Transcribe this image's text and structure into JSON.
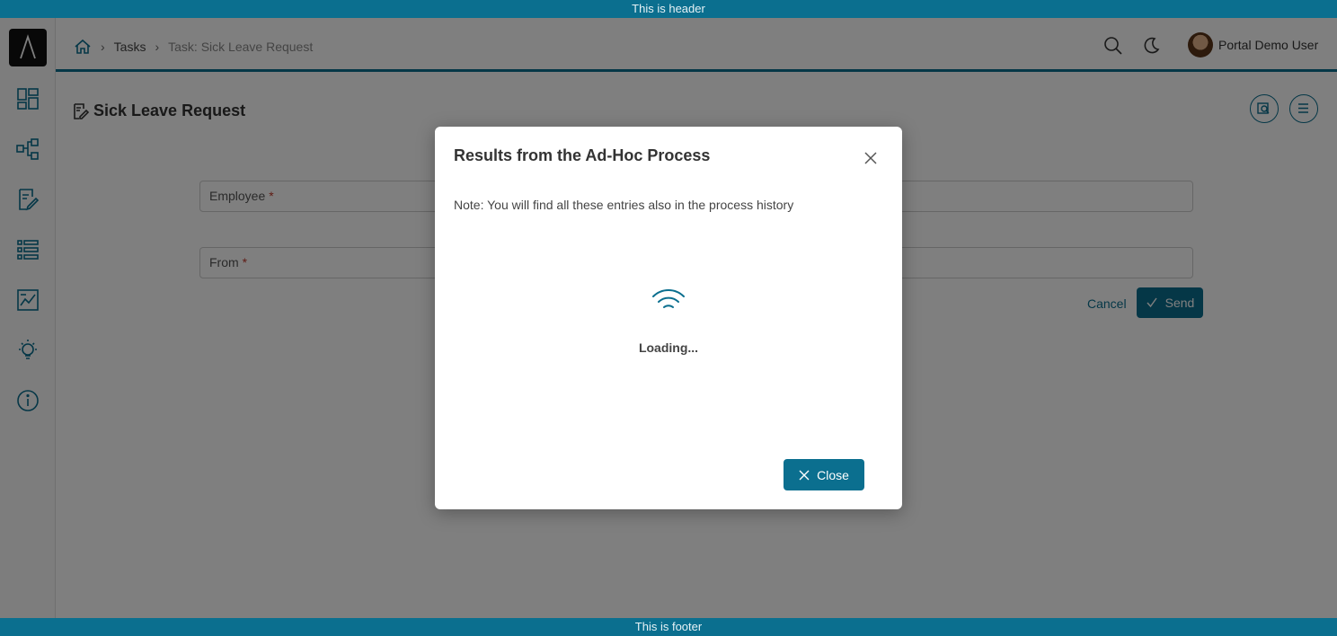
{
  "banner": {
    "header": "This is header",
    "footer": "This is footer"
  },
  "breadcrumb": {
    "tasks": "Tasks",
    "current": "Task: Sick Leave Request"
  },
  "user": {
    "name": "Portal Demo User"
  },
  "page": {
    "title": "Sick Leave Request"
  },
  "form": {
    "employee_label": "Employee",
    "from_label": "From",
    "required_mark": "*",
    "cancel_label": "Cancel",
    "send_label": "Send"
  },
  "dialog": {
    "title": "Results from the Ad-Hoc Process",
    "note": "Note: You will find all these entries also in the process history",
    "loading": "Loading...",
    "close_label": "Close"
  },
  "colors": {
    "accent": "#0b6f8f",
    "required": "#c0392b"
  },
  "icons": {
    "sidebar": [
      "dashboard-icon",
      "process-icon",
      "tasks-icon",
      "list-icon",
      "statistics-icon",
      "ideas-icon",
      "info-icon"
    ],
    "header": [
      "home-icon",
      "search-icon",
      "dark-mode-icon"
    ]
  }
}
